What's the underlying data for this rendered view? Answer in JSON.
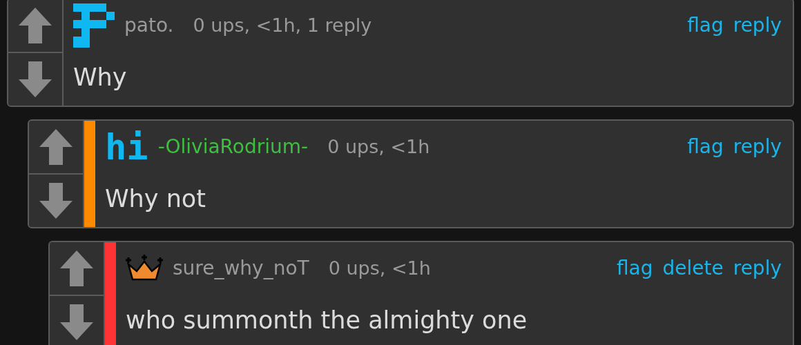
{
  "comments": [
    {
      "badge": {
        "kind": "pixel"
      },
      "username": {
        "text": "pato.",
        "color": "#9a9a9a"
      },
      "meta": "0 ups, <1h, 1 reply",
      "actions": [
        "flag",
        "reply"
      ],
      "body": "Why"
    },
    {
      "badge": {
        "kind": "text",
        "text": "hi"
      },
      "username": {
        "text": "-OliviaRodrium-",
        "color": "#3fbf3f"
      },
      "stripe": {
        "color": "#ff8a00"
      },
      "meta": "0 ups, <1h",
      "actions": [
        "flag",
        "reply"
      ],
      "body": "Why not"
    },
    {
      "badge": {
        "kind": "crown"
      },
      "username": {
        "text": "sure_why_noT",
        "color": "#9a9a9a"
      },
      "stripe": {
        "color": "#ff3333"
      },
      "meta": "0 ups, <1h",
      "actions": [
        "flag",
        "delete",
        "reply"
      ],
      "body": "who summonth the almighty one"
    }
  ]
}
